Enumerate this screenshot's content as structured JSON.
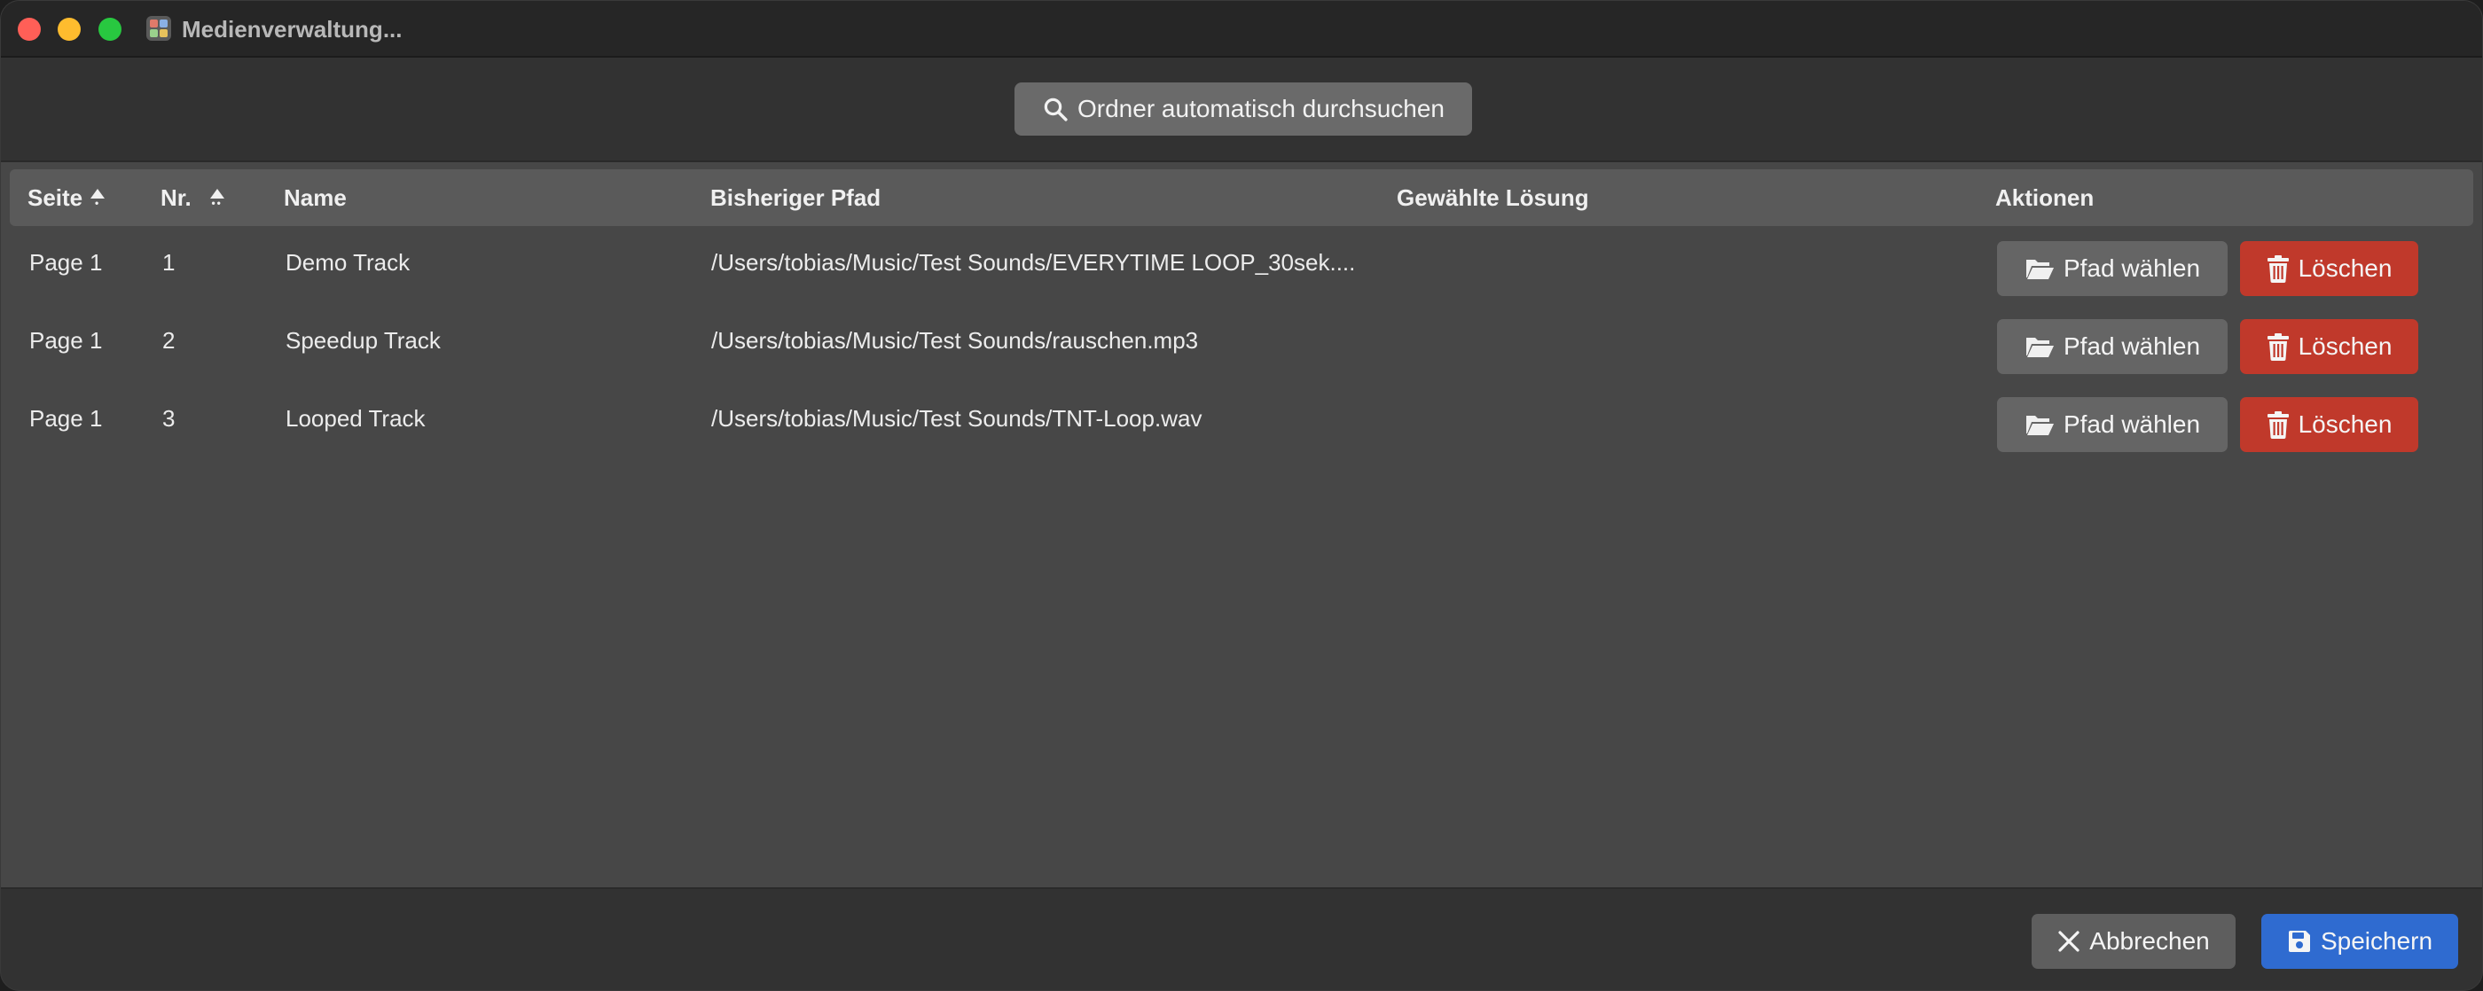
{
  "window": {
    "title": "Medienverwaltung...",
    "traffic_lights": [
      "close",
      "minimize",
      "maximize"
    ]
  },
  "toolbar": {
    "scan_label": "Ordner automatisch durchsuchen",
    "scan_icon": "search-icon"
  },
  "table": {
    "columns": [
      "Seite",
      "Nr.",
      "Name",
      "Bisheriger Pfad",
      "Gewählte Lösung",
      "Aktionen"
    ],
    "rows": [
      {
        "seite": "Page 1",
        "nr": "1",
        "name": "Demo Track",
        "pfad": "/Users/tobias/Music/Test Sounds/EVERYTIME LOOP_30sek....",
        "loesung": ""
      },
      {
        "seite": "Page 1",
        "nr": "2",
        "name": "Speedup Track",
        "pfad": "/Users/tobias/Music/Test Sounds/rauschen.mp3",
        "loesung": ""
      },
      {
        "seite": "Page 1",
        "nr": "3",
        "name": "Looped Track",
        "pfad": "/Users/tobias/Music/Test Sounds/TNT-Loop.wav",
        "loesung": ""
      }
    ],
    "actions": {
      "choose_path_label": "Pfad wählen",
      "choose_path_icon": "folder-open-icon",
      "delete_label": "Löschen",
      "delete_icon": "trash-icon"
    }
  },
  "footer": {
    "cancel_label": "Abbrechen",
    "cancel_icon": "close-icon",
    "save_label": "Speichern",
    "save_icon": "save-icon"
  },
  "colors": {
    "delete_button": "#c0392b",
    "save_button": "#2f6bd0",
    "window_background": "#323232",
    "table_background": "#474747"
  }
}
